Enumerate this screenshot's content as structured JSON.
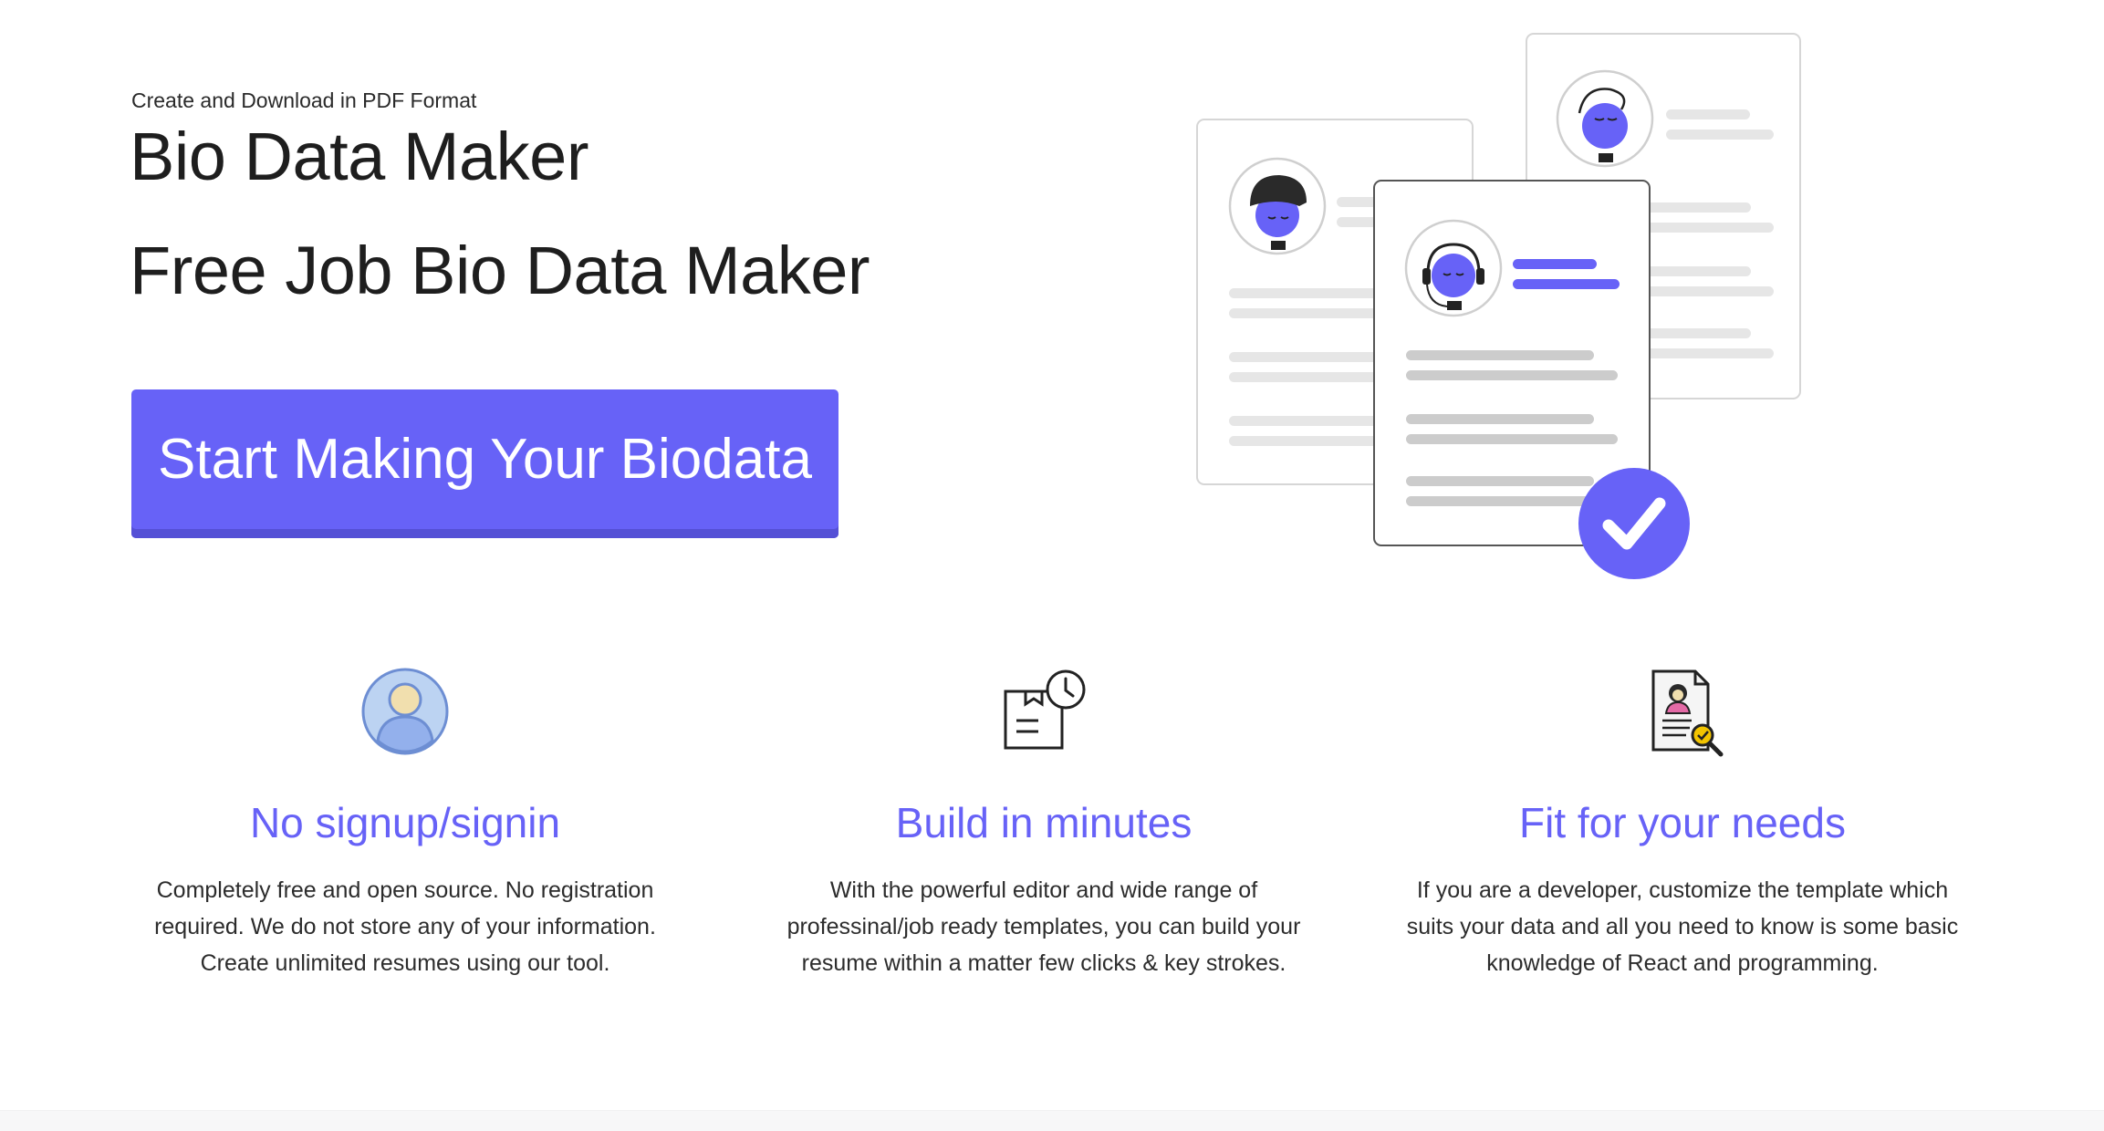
{
  "hero": {
    "eyebrow": "Create and Download in PDF Format",
    "title": "Bio Data Maker",
    "subtitle": "Free Job Bio Data Maker",
    "cta_label": "Start Making Your Biodata"
  },
  "features": [
    {
      "icon": "user-avatar-icon",
      "title": "No signup/signin",
      "desc": "Completely free and open source. No registration required. We do not store any of your information. Create unlimited resumes using our tool."
    },
    {
      "icon": "document-clock-icon",
      "title": "Build in minutes",
      "desc": "With the powerful editor and wide range of professinal/job ready templates, you can build your resume within a matter few clicks & key strokes."
    },
    {
      "icon": "resume-search-icon",
      "title": "Fit for your needs",
      "desc": "If you are a developer, customize the template which suits your data and all you need to know is some basic knowledge of React and programming."
    }
  ],
  "colors": {
    "accent": "#6762f7",
    "text": "#1e1e1e",
    "line_light": "#e6e6e6",
    "line_mid": "#cccccc"
  }
}
